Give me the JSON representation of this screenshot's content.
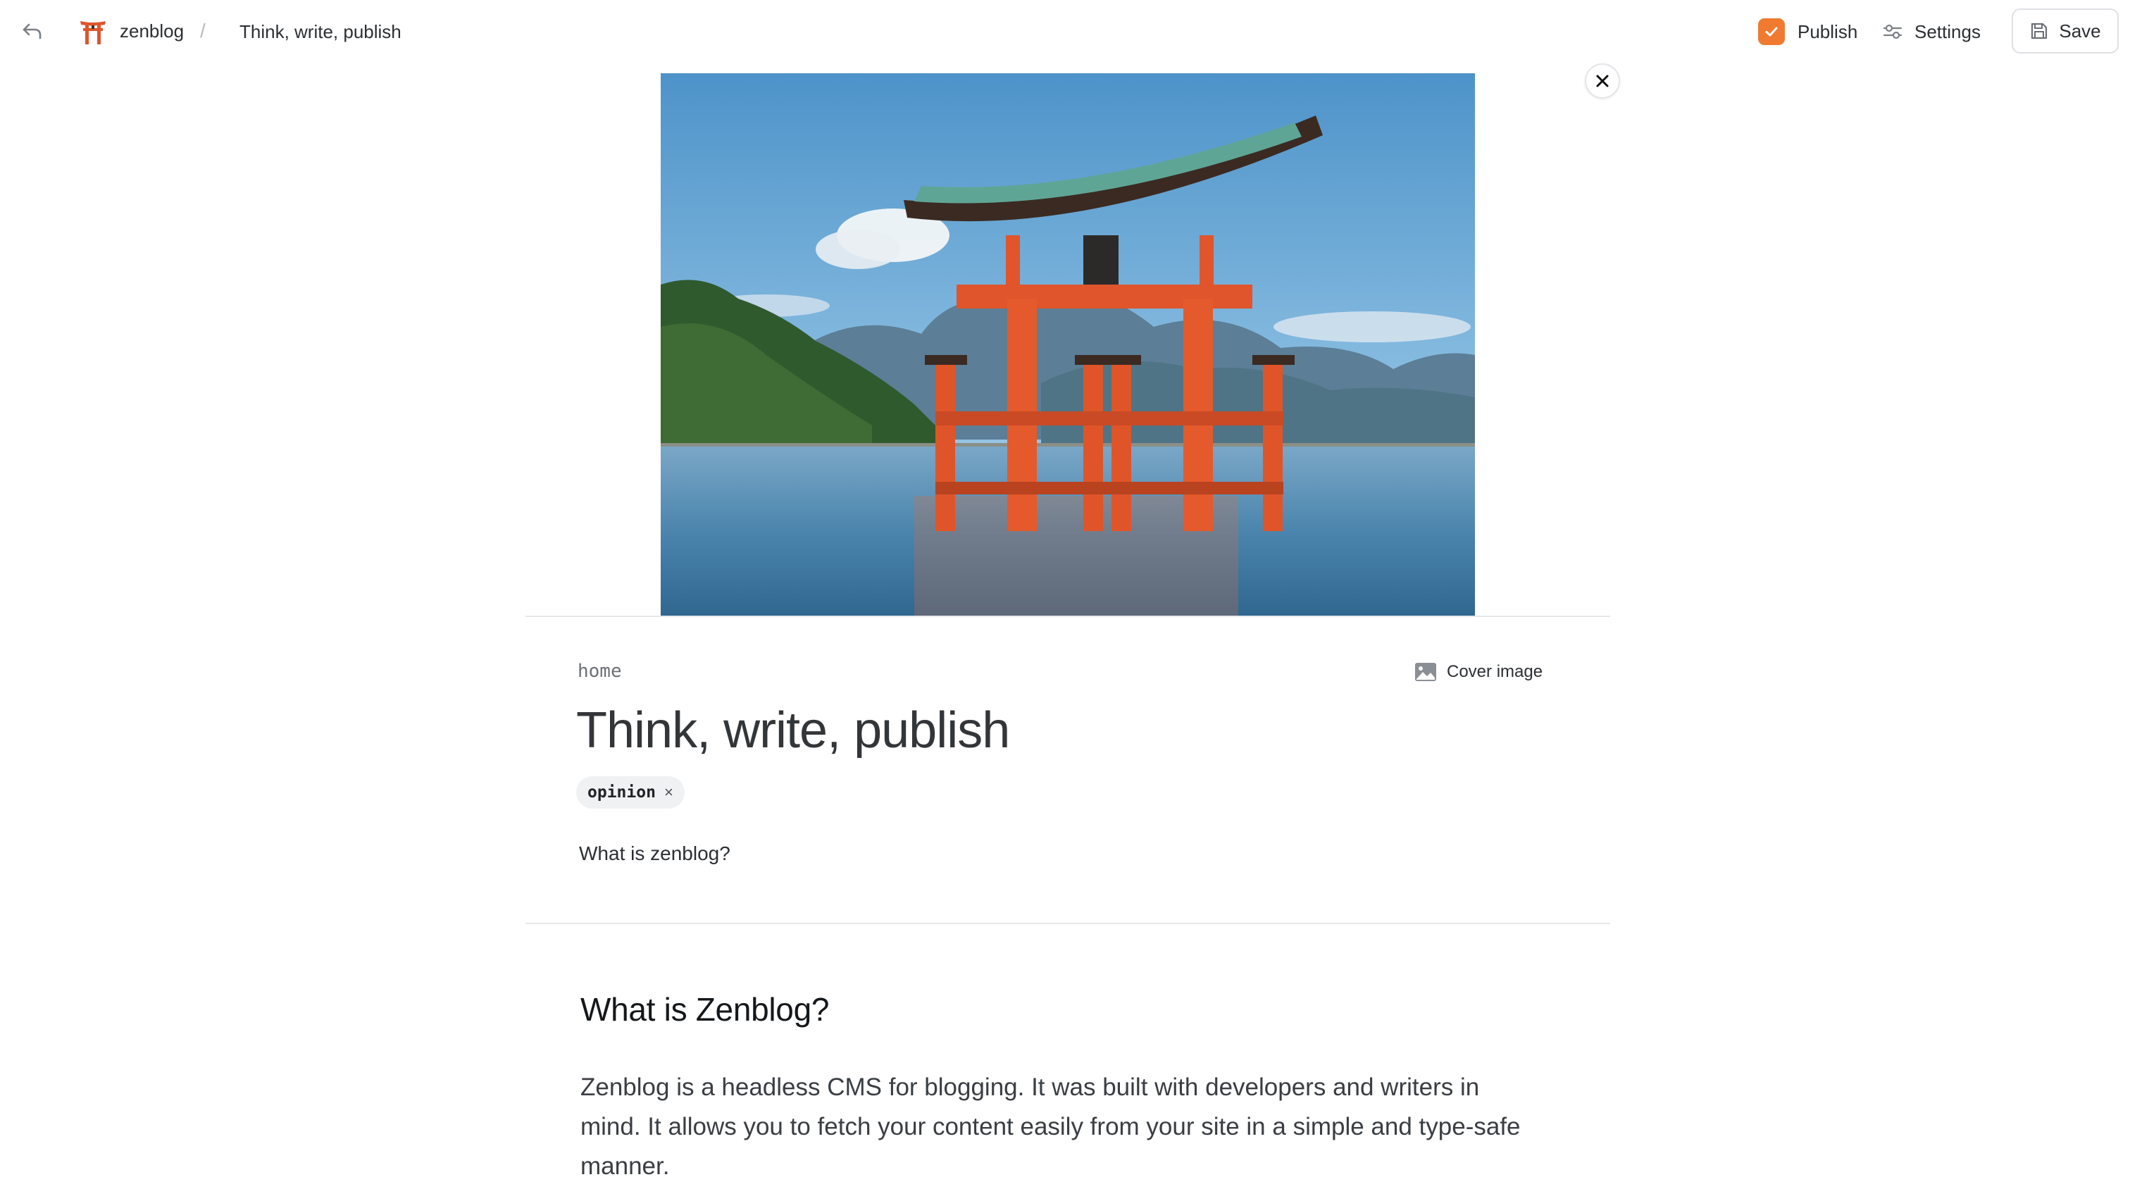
{
  "header": {
    "brand_name": "zenblog",
    "breadcrumb_separator": "/",
    "breadcrumb_title": "Think, write, publish",
    "publish_label": "Publish",
    "settings_label": "Settings",
    "save_label": "Save"
  },
  "post": {
    "slug": "home",
    "cover_image_label": "Cover image",
    "title": "Think, write, publish",
    "tags": [
      {
        "label": "opinion",
        "remove": "×"
      }
    ],
    "excerpt": "What is zenblog?"
  },
  "content": {
    "heading": "What is Zenblog?",
    "paragraph": "Zenblog is a headless CMS for blogging. It was built with developers and writers in mind. It allows you to fetch your content easily from your site in a simple and type-safe manner."
  },
  "colors": {
    "accent": "#f07a2f",
    "torii": "#e0552b",
    "divider": "#e6e8eb"
  },
  "icons": {
    "back": "undo-arrow-icon",
    "brand": "torii-gate-icon",
    "publish": "check-icon",
    "settings": "sliders-icon",
    "save": "floppy-disk-icon",
    "close": "close-icon",
    "cover": "image-icon"
  }
}
